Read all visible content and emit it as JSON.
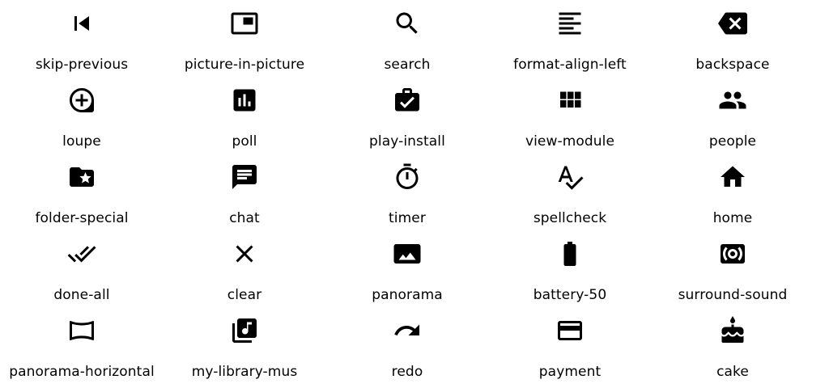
{
  "icons": [
    {
      "label": "skip-previous"
    },
    {
      "label": "picture-in-picture"
    },
    {
      "label": "search"
    },
    {
      "label": "format-align-left"
    },
    {
      "label": "backspace"
    },
    {
      "label": "loupe"
    },
    {
      "label": "poll"
    },
    {
      "label": "play-install"
    },
    {
      "label": "view-module"
    },
    {
      "label": "people"
    },
    {
      "label": "folder-special"
    },
    {
      "label": "chat"
    },
    {
      "label": "timer"
    },
    {
      "label": "spellcheck"
    },
    {
      "label": "home"
    },
    {
      "label": "done-all"
    },
    {
      "label": "clear"
    },
    {
      "label": "panorama"
    },
    {
      "label": "battery-50"
    },
    {
      "label": "surround-sound"
    },
    {
      "label": "panorama-horizontal"
    },
    {
      "label": "my-library-mus"
    },
    {
      "label": "redo"
    },
    {
      "label": "payment"
    },
    {
      "label": "cake"
    }
  ]
}
